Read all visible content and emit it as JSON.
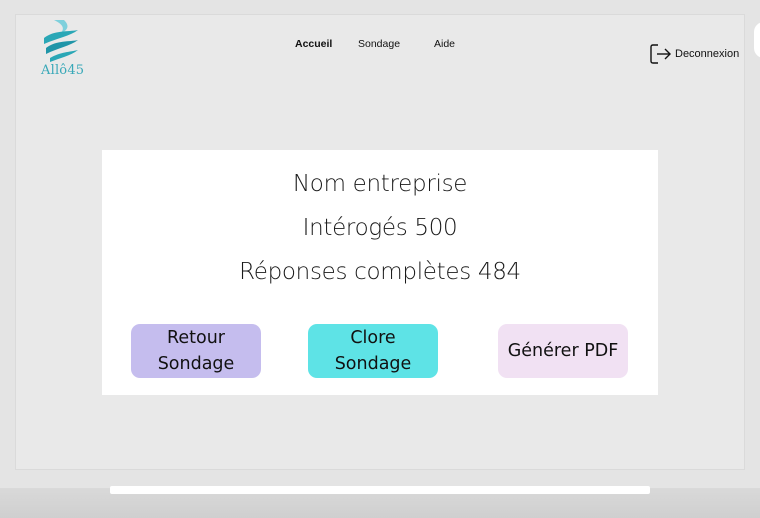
{
  "app": {
    "logo_text": "Allô45"
  },
  "nav": {
    "items": [
      {
        "label": "Accueil",
        "active": true
      },
      {
        "label": "Sondage",
        "active": false
      },
      {
        "label": "Aide",
        "active": false
      }
    ],
    "logout_label": "Deconnexion",
    "logout_icon": "logout-icon"
  },
  "summary": {
    "company_label": "Nom entreprise",
    "surveyed_label": "Intérogés 500",
    "completed_label": "Réponses complètes 484"
  },
  "actions": {
    "back_label": "Retour Sondage",
    "close_label": "Clore Sondage",
    "pdf_label": "Générer PDF"
  },
  "colors": {
    "brand": "#38a8b8",
    "back_button": "#c5bdee",
    "close_button": "#5ee3e6",
    "pdf_button": "#f1e1f3"
  }
}
